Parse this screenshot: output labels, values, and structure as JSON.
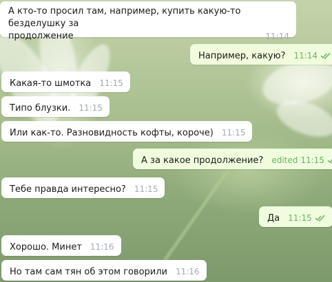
{
  "messages": [
    {
      "dir": "in",
      "lines": [
        "А кто-то просил там, например, купить какую-то безделушку за",
        "продолжение"
      ],
      "time": "11:14"
    },
    {
      "dir": "out",
      "text": "Например, какую?",
      "time": "11:14",
      "read": true
    },
    {
      "dir": "in",
      "text": "Какая-то шмотка",
      "time": "11:15"
    },
    {
      "dir": "in",
      "text": "Типо блузки.",
      "time": "11:15"
    },
    {
      "dir": "in",
      "text": "Или как-то. Разновидность кофты, короче)",
      "time": "11:15"
    },
    {
      "dir": "out",
      "text": "А за какое продолжение?",
      "time": "11:15",
      "edited": "edited",
      "read": true
    },
    {
      "dir": "in",
      "text": "Тебе правда интересно?",
      "time": "11:15"
    },
    {
      "dir": "out",
      "text": "Да",
      "time": "11:15",
      "read": true
    },
    {
      "dir": "in",
      "text": "Хорошо. Минет",
      "time": "11:16"
    },
    {
      "dir": "in",
      "text": "Но там сам тян об этом говорили",
      "time": "11:16"
    }
  ],
  "colors": {
    "incoming": "#ffffff",
    "outgoing": "#effdde",
    "time_in": "#a0acb6",
    "time_out": "#6cb35e"
  },
  "icons": {
    "read_receipt": "double-check-icon"
  }
}
